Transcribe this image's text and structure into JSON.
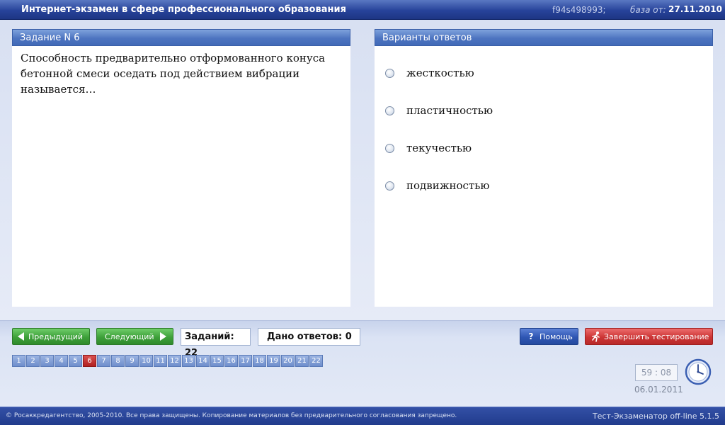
{
  "header": {
    "title": "Интернет-экзамен в сфере профессионального образования",
    "code": "f94s498993;",
    "base_label": "база от:",
    "base_date": "27.11.2010"
  },
  "task": {
    "heading": "Задание N 6",
    "question": "Способность предварительно отформованного конуса бетонной смеси оседать под действием вибрации называется…"
  },
  "answers": {
    "heading": "Варианты ответов",
    "options": [
      {
        "label": "жесткостью"
      },
      {
        "label": "пластичностью"
      },
      {
        "label": "текучестью"
      },
      {
        "label": "подвижностью"
      }
    ]
  },
  "nav": {
    "prev_label": "Предыдущий",
    "next_label": "Следующий",
    "tasks_count": "Заданий: 22",
    "answers_given": "Дано ответов: 0",
    "help_label": "Помощь",
    "finish_label": "Завершить тестирование"
  },
  "pages": [
    "1",
    "2",
    "3",
    "4",
    "5",
    "6",
    "7",
    "8",
    "9",
    "10",
    "11",
    "12",
    "13",
    "14",
    "15",
    "16",
    "17",
    "18",
    "19",
    "20",
    "21",
    "22"
  ],
  "current_page": "6",
  "timer": "59 : 08",
  "date": "06.01.2011",
  "footer": {
    "copyright": "© Росаккредагентство, 2005-2010. Все права защищены. Копирование материалов без предварительного согласования запрещено.",
    "version": "Тест-Экзаменатор off-line 5.1.5"
  },
  "colors": {
    "header": "#27439a",
    "panel_head": "#4d74c0",
    "green_button": "#3ea03a",
    "blue_button": "#2f56b3",
    "red_button": "#cc3535",
    "current_page": "#b02020"
  },
  "icons": {
    "prev": "arrow-left-icon",
    "next": "arrow-right-icon",
    "help": "question-icon",
    "finish": "running-man-icon",
    "clock": "clock-icon"
  }
}
